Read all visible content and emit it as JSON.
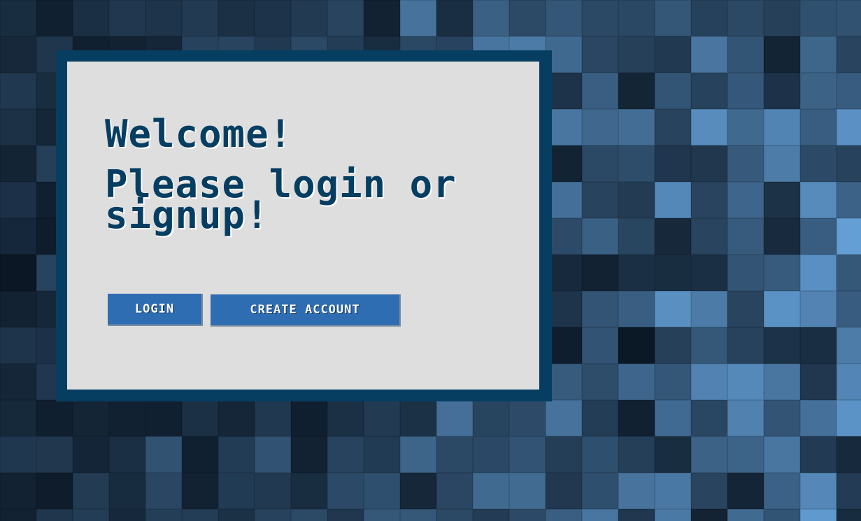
{
  "welcome_text": "Welcome!",
  "prompt_text": "Please login or signup!",
  "buttons": {
    "login_label": "LOGIN",
    "create_account_label": "CREATE ACCOUNT"
  },
  "colors": {
    "panel_border": "#063e62",
    "panel_background": "#dedede",
    "button_background": "#2f6db3",
    "heading_text": "#063e62"
  }
}
